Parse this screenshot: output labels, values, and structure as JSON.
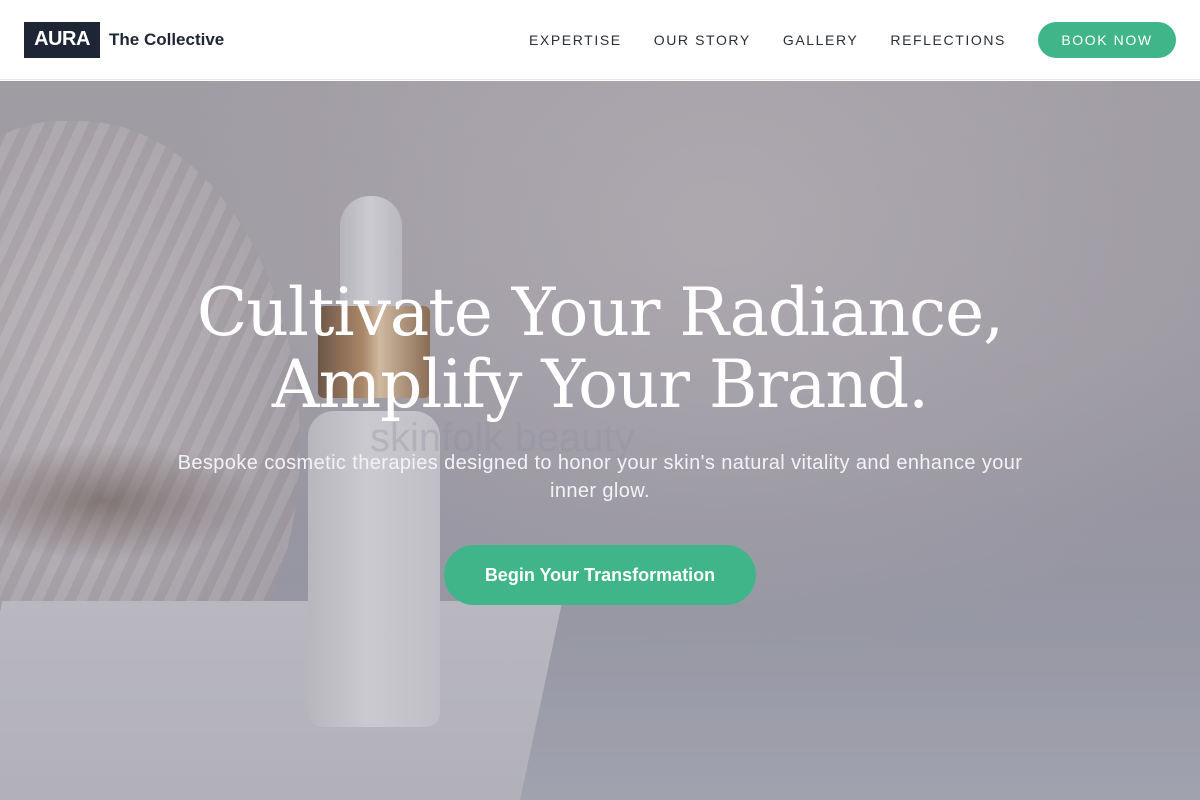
{
  "header": {
    "logo": "AURA",
    "brand_name": "The Collective",
    "nav": [
      "EXPERTISE",
      "OUR STORY",
      "GALLERY",
      "REFLECTIONS"
    ],
    "book_label": "BOOK NOW"
  },
  "hero": {
    "headline_line1": "Cultivate Your Radiance,",
    "headline_line2": "Amplify Your Brand.",
    "subtext": "Bespoke cosmetic therapies designed to honor your skin's natural vitality and enhance your inner glow.",
    "cta_label": "Begin Your Transformation",
    "watermark": "skinfolk beauty"
  },
  "colors": {
    "accent": "#3fb589",
    "logo_bg": "#1e2635",
    "text_dark": "#2a2f38"
  }
}
